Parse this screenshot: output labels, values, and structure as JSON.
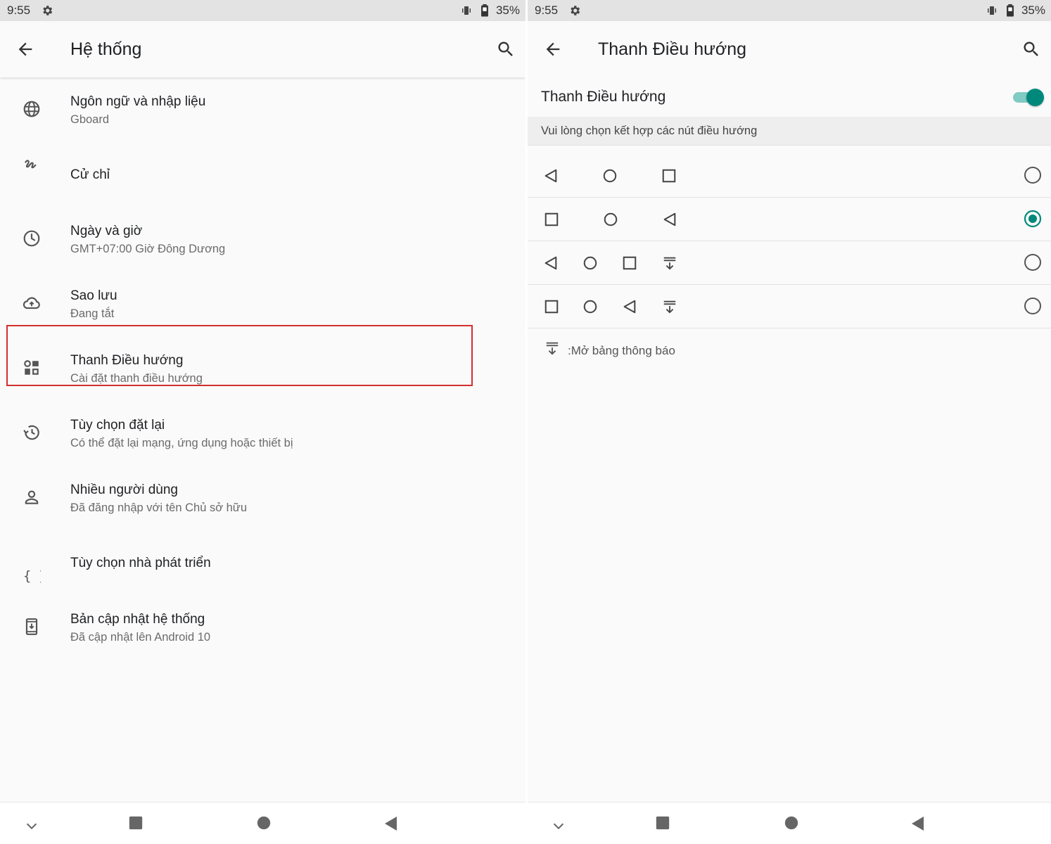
{
  "left": {
    "status": {
      "time": "9:55",
      "battery": "35%"
    },
    "appbar": {
      "title": "Hệ thống"
    },
    "items": [
      {
        "title": "Ngôn ngữ và nhập liệu",
        "subtitle": "Gboard",
        "icon": "globe-icon"
      },
      {
        "title": "Cử chỉ",
        "subtitle": "",
        "icon": "gesture-icon"
      },
      {
        "title": "Ngày và giờ",
        "subtitle": "GMT+07:00 Giờ Đông Dương",
        "icon": "clock-icon"
      },
      {
        "title": "Sao lưu",
        "subtitle": "Đang tắt",
        "icon": "cloud-upload-icon"
      },
      {
        "title": "Thanh Điều hướng",
        "subtitle": "Cài đặt thanh điều hướng",
        "icon": "dashboard-icon"
      },
      {
        "title": "Tùy chọn đặt lại",
        "subtitle": "Có thể đặt lại mạng, ứng dụng hoặc thiết bị",
        "icon": "history-icon"
      },
      {
        "title": "Nhiều người dùng",
        "subtitle": "Đã đăng nhập với tên Chủ sở hữu",
        "icon": "person-icon"
      },
      {
        "title": "Tùy chọn nhà phát triển",
        "subtitle": "",
        "icon": "braces-icon"
      },
      {
        "title": "Bản cập nhật hệ thống",
        "subtitle": "Đã cập nhật lên Android 10",
        "icon": "system-update-icon"
      }
    ]
  },
  "right": {
    "status": {
      "time": "9:55",
      "battery": "35%"
    },
    "appbar": {
      "title": "Thanh Điều hướng"
    },
    "toggle": {
      "label": "Thanh Điều hướng",
      "on": true
    },
    "hint": "Vui lòng chọn kết hợp các nút điều hướng",
    "combos": [
      {
        "buttons": [
          "back",
          "home",
          "recents"
        ],
        "selected": false
      },
      {
        "buttons": [
          "recents",
          "home",
          "back"
        ],
        "selected": true
      },
      {
        "buttons": [
          "back",
          "home",
          "recents",
          "notification"
        ],
        "selected": false
      },
      {
        "buttons": [
          "recents",
          "home",
          "back",
          "notification"
        ],
        "selected": false
      }
    ],
    "legend": ":Mở bảng thông báo"
  },
  "colors": {
    "accent": "#00897b",
    "accent_track": "#80cbc4",
    "highlight": "#d32f2f"
  }
}
